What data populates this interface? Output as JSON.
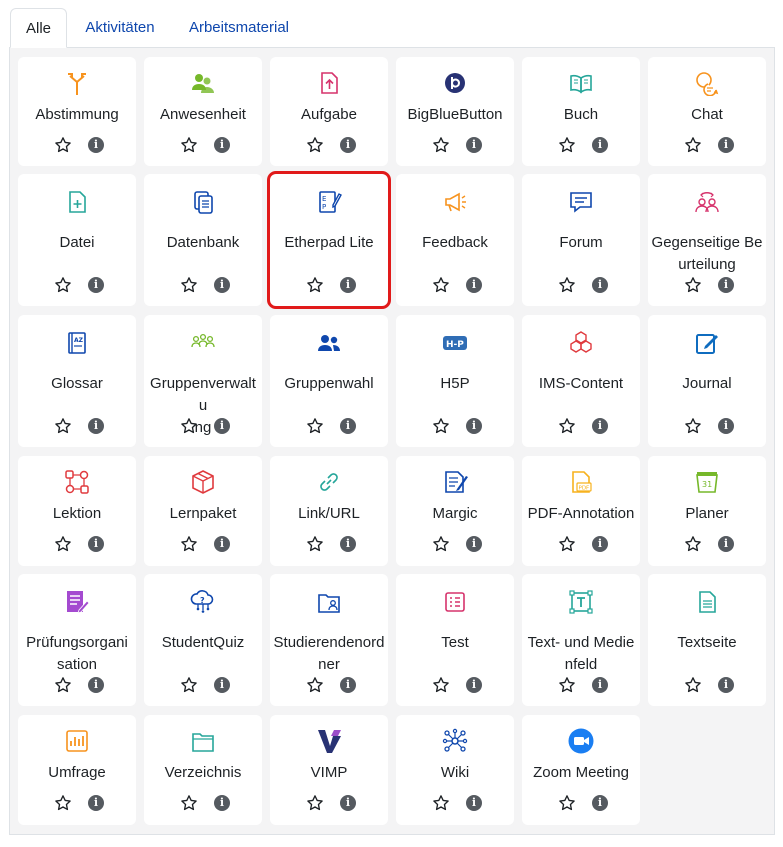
{
  "tabs": [
    {
      "label": "Alle",
      "active": true
    },
    {
      "label": "Aktivitäten",
      "active": false
    },
    {
      "label": "Arbeitsmaterial",
      "active": false
    }
  ],
  "colors": {
    "link": "#0f47ad",
    "panel_bg": "#f4f4f5",
    "selection_outline": "#e11a1a",
    "info_badge": "#555a60"
  },
  "info_glyph": "i",
  "modules": [
    {
      "name": "Abstimmung",
      "icon": "signpost-icon",
      "color": "#f7931e"
    },
    {
      "name": "Anwesenheit",
      "icon": "attendance-icon",
      "color": "#76b82a"
    },
    {
      "name": "Aufgabe",
      "icon": "upload-document-icon",
      "color": "#d6336c"
    },
    {
      "name": "BigBlueButton",
      "icon": "bigbluebutton-icon",
      "color": "#283274"
    },
    {
      "name": "Buch",
      "icon": "book-icon",
      "color": "#26a69a"
    },
    {
      "name": "Chat",
      "icon": "chat-bubbles-icon",
      "color": "#f7931e"
    },
    {
      "name": "Datei",
      "icon": "file-plus-icon",
      "color": "#26a69a"
    },
    {
      "name": "Datenbank",
      "icon": "database-icon",
      "color": "#0f47ad"
    },
    {
      "name": "Etherpad Lite",
      "icon": "etherpad-icon",
      "color": "#0f47ad",
      "selected": true
    },
    {
      "name": "Feedback",
      "icon": "megaphone-icon",
      "color": "#f7931e"
    },
    {
      "name": "Forum",
      "icon": "forum-icon",
      "color": "#0f47ad"
    },
    {
      "name": "Gegenseitige Beurteilung",
      "icon": "peer-review-icon",
      "color": "#d6336c"
    },
    {
      "name": "Glossar",
      "icon": "glossary-icon",
      "color": "#0f47ad"
    },
    {
      "name": "Gruppenverwaltung",
      "icon": "group-management-icon",
      "color": "#76b82a"
    },
    {
      "name": "Gruppenwahl",
      "icon": "group-choice-icon",
      "color": "#0f47ad"
    },
    {
      "name": "H5P",
      "icon": "h5p-icon",
      "color": "#2f6db5"
    },
    {
      "name": "IMS-Content",
      "icon": "cubes-icon",
      "color": "#e03a3e"
    },
    {
      "name": "Journal",
      "icon": "journal-edit-icon",
      "color": "#0f6cbf"
    },
    {
      "name": "Lektion",
      "icon": "lesson-flow-icon",
      "color": "#e03a3e"
    },
    {
      "name": "Lernpaket",
      "icon": "package-box-icon",
      "color": "#e03a3e"
    },
    {
      "name": "Link/URL",
      "icon": "link-icon",
      "color": "#26a69a"
    },
    {
      "name": "Margic",
      "icon": "margic-icon",
      "color": "#0f47ad"
    },
    {
      "name": "PDF-Annotation",
      "icon": "pdf-icon",
      "color": "#f7b21e"
    },
    {
      "name": "Planer",
      "icon": "calendar-planner-icon",
      "color": "#76b82a"
    },
    {
      "name": "Prüfungsorganisation",
      "icon": "exam-organization-icon",
      "color": "#a44ad0"
    },
    {
      "name": "StudentQuiz",
      "icon": "student-quiz-icon",
      "color": "#0f47ad"
    },
    {
      "name": "Studierendenordner",
      "icon": "student-folder-icon",
      "color": "#0f47ad"
    },
    {
      "name": "Test",
      "icon": "test-list-icon",
      "color": "#d6336c"
    },
    {
      "name": "Text- und Medienfeld",
      "icon": "text-media-field-icon",
      "color": "#26a69a"
    },
    {
      "name": "Textseite",
      "icon": "text-page-icon",
      "color": "#26a69a"
    },
    {
      "name": "Umfrage",
      "icon": "bar-chart-icon",
      "color": "#f7931e"
    },
    {
      "name": "Verzeichnis",
      "icon": "folder-icon",
      "color": "#26a69a"
    },
    {
      "name": "VIMP",
      "icon": "vimp-icon",
      "color": "#283274"
    },
    {
      "name": "Wiki",
      "icon": "wiki-network-icon",
      "color": "#0f47ad"
    },
    {
      "name": "Zoom Meeting",
      "icon": "zoom-camera-icon",
      "color": "#1a7ef2"
    }
  ]
}
